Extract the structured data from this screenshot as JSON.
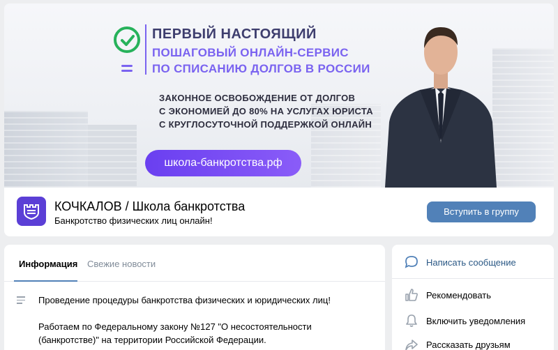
{
  "cover": {
    "headline_1": "ПЕРВЫЙ НАСТОЯЩИЙ",
    "headline_2": "ПОШАГОВЫЙ ОНЛАЙН-СЕРВИС",
    "headline_3": "ПО СПИСАНИЮ ДОЛГОВ В РОССИИ",
    "sub_1": "ЗАКОННОЕ ОСВОБОЖДЕНИЕ ОТ ДОЛГОВ",
    "sub_2": "С ЭКОНОМИЕЙ ДО 80% НА УСЛУГАХ ЮРИСТА",
    "sub_3": "С КРУГЛОСУТОЧНОЙ ПОДДЕРЖКОЙ ОНЛАЙН",
    "site_button": "школа-банкротства.рф"
  },
  "group": {
    "name": "КОЧКАЛОВ / Школа банкротства",
    "status": "Банкротство физических лиц онлайн!",
    "join_button": "Вступить в группу"
  },
  "tabs": [
    {
      "label": "Информация",
      "active": true
    },
    {
      "label": "Свежие новости",
      "active": false
    }
  ],
  "info": {
    "description": "Проведение процедуры банкротства физических и юридических лиц!",
    "law_line_1": "Работаем по Федеральному закону №127 \"О несостоятельности",
    "law_line_2": "(банкротстве)\" на территории Российской Федерации."
  },
  "actions": [
    {
      "label": "Написать сообщение",
      "icon": "message-icon"
    },
    {
      "label": "Рекомендовать",
      "icon": "thumbs-up-icon"
    },
    {
      "label": "Включить уведомления",
      "icon": "bell-icon"
    },
    {
      "label": "Рассказать друзьям",
      "icon": "share-icon"
    }
  ],
  "colors": {
    "accent": "#5181b8",
    "purple": "#7a63f0",
    "green": "#27b25b"
  }
}
